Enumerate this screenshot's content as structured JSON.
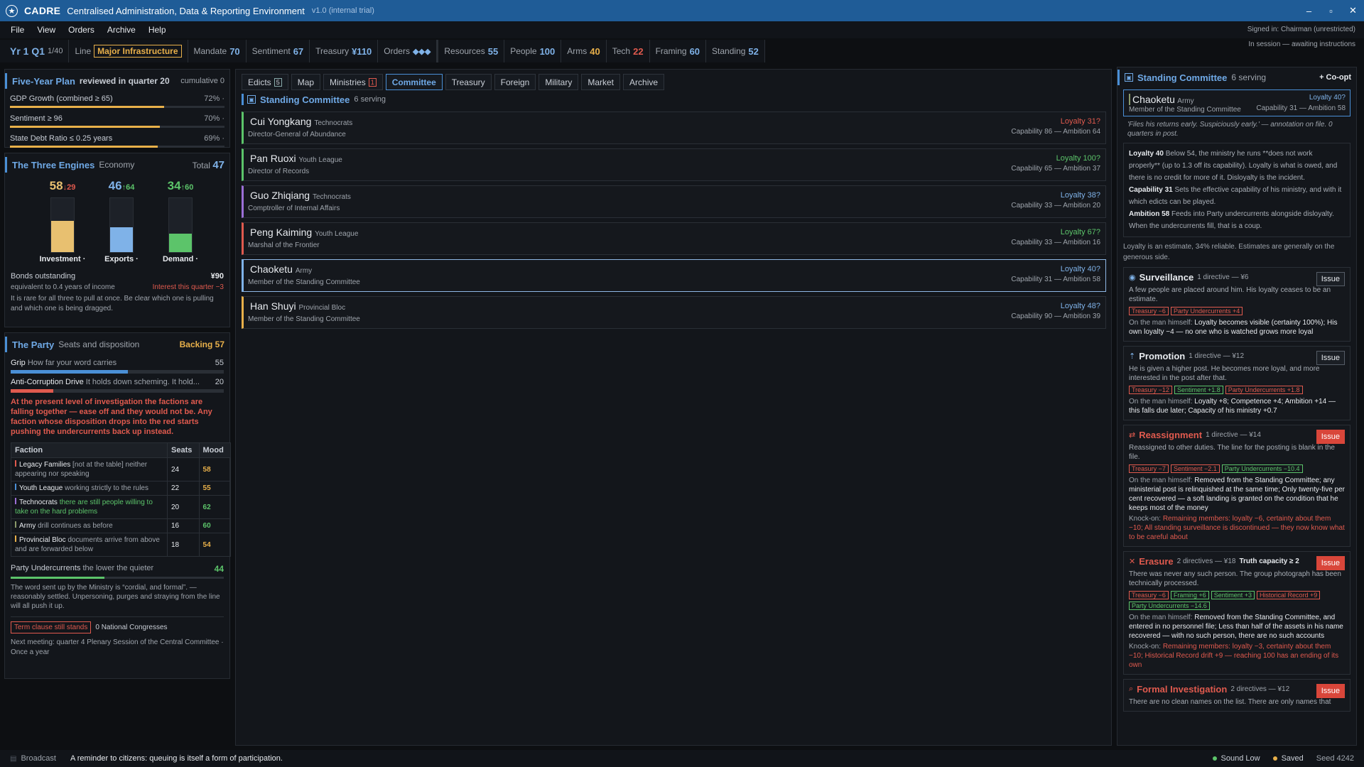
{
  "window": {
    "app_name": "CADRE",
    "full_name": "Centralised Administration, Data & Reporting Environment",
    "version": "v1.0 (internal trial)"
  },
  "menu": [
    "File",
    "View",
    "Orders",
    "Archive",
    "Help"
  ],
  "signed_in": "Signed in: Chairman (unrestricted)",
  "session": "In session — awaiting instructions",
  "stats": {
    "period": "Yr 1 Q1",
    "period_count": "1/40",
    "line_label": "Line",
    "line_value": "Major Infrastructure",
    "mandate_label": "Mandate",
    "mandate": "70",
    "sentiment_label": "Sentiment",
    "sentiment": "67",
    "treasury_label": "Treasury",
    "treasury": "¥110",
    "orders_label": "Orders",
    "orders": "◆◆◆",
    "resources_label": "Resources",
    "resources": "55",
    "people_label": "People",
    "people": "100",
    "arms_label": "Arms",
    "arms": "40",
    "tech_label": "Tech",
    "tech": "22",
    "framing_label": "Framing",
    "framing": "60",
    "standing_label": "Standing",
    "standing": "52"
  },
  "plan": {
    "title": "Five-Year Plan",
    "sub": "reviewed in quarter 20",
    "right": "cumulative 0",
    "goals": [
      {
        "label": "GDP Growth (combined ≥ 65)",
        "pct": "72% ·",
        "fill": 72
      },
      {
        "label": "Sentiment ≥ 96",
        "pct": "70% ·",
        "fill": 70
      },
      {
        "label": "State Debt Ratio ≤ 0.25 years",
        "pct": "69% ·",
        "fill": 69
      }
    ]
  },
  "engines": {
    "title": "The Three Engines",
    "sub": "Economy",
    "total_label": "Total",
    "total": "47",
    "items": [
      {
        "name": "Investment ·",
        "value": "58",
        "delta": "↓29",
        "fill": 0.58,
        "color": "#e8c070"
      },
      {
        "name": "Exports ·",
        "value": "46",
        "delta": "↑64",
        "fill": 0.46,
        "color": "#7fb2e8"
      },
      {
        "name": "Demand ·",
        "value": "34",
        "delta": "↑60",
        "fill": 0.34,
        "color": "#5cc46a"
      }
    ],
    "bonds_label": "Bonds outstanding",
    "bonds": "¥90",
    "bonds_note": "equivalent to 0.4 years of income",
    "interest": "Interest this quarter −3",
    "note": "It is rare for all three to pull at once. Be clear which one is pulling and which one is being dragged."
  },
  "party": {
    "title": "The Party",
    "sub": "Seats and disposition",
    "backing": "Backing 57",
    "grip_label": "Grip",
    "grip_note": "How far your word carries",
    "grip": "55",
    "grip_fill": 0.55,
    "acd_label": "Anti-Corruption Drive",
    "acd_note": "It holds down scheming. It hold...",
    "acd": "20",
    "acd_fill": 0.2,
    "warning": "At the present level of investigation the factions are falling together — ease off and they would not be. Any faction whose disposition drops into the red starts pushing the undercurrents back up instead.",
    "col_faction": "Faction",
    "col_seats": "Seats",
    "col_mood": "Mood",
    "factions": [
      {
        "name": "Legacy Families",
        "note": "[not at the table] neither appearing nor speaking",
        "seats": "24",
        "mood": "58",
        "color": "#e05a4e"
      },
      {
        "name": "Youth League",
        "note": "working strictly to the rules",
        "seats": "22",
        "mood": "55",
        "color": "#4a8fd6"
      },
      {
        "name": "Technocrats",
        "note": "there are still people willing to take on the hard problems",
        "seats": "20",
        "mood": "62",
        "color": "#9b6fd6"
      },
      {
        "name": "Army",
        "note": "drill continues as before",
        "seats": "16",
        "mood": "60",
        "color": "#8a9a6a"
      },
      {
        "name": "Provincial Bloc",
        "note": "documents arrive from above and are forwarded below",
        "seats": "18",
        "mood": "54",
        "color": "#e8b04a"
      }
    ],
    "under_label": "Party Undercurrents",
    "under_note": "the lower the quieter",
    "under": "44",
    "under_fill": 0.44,
    "word": "The word sent up by the Ministry is “cordial, and formal”. — reasonably settled. Unpersoning, purges and straying from the line will all push it up.",
    "term": "Term clause still stands",
    "congress": "0 National Congresses",
    "next_meeting": "Next meeting: quarter 4 Plenary Session of the Central Committee · Once a year"
  },
  "tabs": [
    {
      "label": "Edicts",
      "badge": "5"
    },
    {
      "label": "Map"
    },
    {
      "label": "Ministries",
      "badge": "1",
      "red": true
    },
    {
      "label": "Committee",
      "active": true
    },
    {
      "label": "Treasury"
    },
    {
      "label": "Foreign"
    },
    {
      "label": "Military"
    },
    {
      "label": "Market"
    },
    {
      "label": "Archive"
    }
  ],
  "committee": {
    "title": "Standing Committee",
    "count": "6 serving",
    "members": [
      {
        "name": "Cui Yongkang",
        "faction": "Technocrats",
        "role": "Director-General of Abundance",
        "loyalty": "Loyalty 31?",
        "loy_color": "#e05a4e",
        "cap": "Capability 86 — Ambition 64",
        "color": "#5cc46a"
      },
      {
        "name": "Pan Ruoxi",
        "faction": "Youth League",
        "role": "Director of Records",
        "loyalty": "Loyalty 100?",
        "loy_color": "#5cc46a",
        "cap": "Capability 65 — Ambition 37",
        "color": "#5cc46a"
      },
      {
        "name": "Guo Zhiqiang",
        "faction": "Technocrats",
        "role": "Comptroller of Internal Affairs",
        "loyalty": "Loyalty 38?",
        "loy_color": "#7fb2e8",
        "cap": "Capability 33 — Ambition 20",
        "color": "#9b6fd6"
      },
      {
        "name": "Peng Kaiming",
        "faction": "Youth League",
        "role": "Marshal of the Frontier",
        "loyalty": "Loyalty 67?",
        "loy_color": "#5cc46a",
        "cap": "Capability 33 — Ambition 16",
        "color": "#e05a4e"
      },
      {
        "name": "Chaoketu",
        "faction": "Army",
        "role": "Member of the Standing Committee",
        "loyalty": "Loyalty 40?",
        "loy_color": "#7fb2e8",
        "cap": "Capability 31 — Ambition 58",
        "color": "#7fb2e8",
        "selected": true
      },
      {
        "name": "Han Shuyi",
        "faction": "Provincial Bloc",
        "role": "Member of the Standing Committee",
        "loyalty": "Loyalty 48?",
        "loy_color": "#7fb2e8",
        "cap": "Capability 90 — Ambition 39",
        "color": "#e8b04a"
      }
    ]
  },
  "detail": {
    "title": "Standing Committee",
    "count": "6 serving",
    "coopt": "+ Co-opt",
    "name": "Chaoketu",
    "faction": "Army",
    "loyalty": "Loyalty 40?",
    "role": "Member of the Standing Committee",
    "cap": "Capability 31 — Ambition 58",
    "quote": "'Files his returns early. Suspiciously early.' — annotation on file. 0 quarters in post.",
    "loy_label": "Loyalty 40",
    "loy_text": "Below 54, the ministry he runs **does not work properly** (up to 1.3 off its capability). Loyalty is what is owed, and there is no credit for more of it. Disloyalty is the incident.",
    "cap_label": "Capability 31",
    "cap_text": "Sets the effective capability of his ministry, and with it which edicts can be played.",
    "amb_label": "Ambition 58",
    "amb_text": "Feeds into Party undercurrents alongside disloyalty. When the undercurrents fill, that is a coup.",
    "estimate": "Loyalty is an estimate, 34% reliable. Estimates are generally on the generous side.",
    "directives": [
      {
        "name": "Surveillance",
        "meta": "1 directive — ¥6",
        "hot": false,
        "icon": "eye-icon",
        "glyph": "◉",
        "desc": "A few people are placed around him. His loyalty ceases to be an estimate.",
        "chips": [
          {
            "t": "Treasury −6"
          },
          {
            "t": "Party Undercurrents +4"
          }
        ],
        "man_label": "On the man himself:",
        "man": "Loyalty becomes visible (certainty 100%); His own loyalty −4 — no one who is watched grows more loyal"
      },
      {
        "name": "Promotion",
        "meta": "1 directive — ¥12",
        "hot": false,
        "icon": "person-up-icon",
        "glyph": "⇡",
        "desc": "He is given a higher post. He becomes more loyal, and more interested in the post after that.",
        "chips": [
          {
            "t": "Treasury −12"
          },
          {
            "t": "Sentiment +1.8",
            "g": true
          },
          {
            "t": "Party Undercurrents +1.8"
          }
        ],
        "man_label": "On the man himself:",
        "man": "Loyalty +8; Competence +4; Ambition +14 — this falls due later; Capacity of his ministry +0.7"
      },
      {
        "name": "Reassignment",
        "meta": "1 directive — ¥14",
        "hot": true,
        "icon": "person-move-icon",
        "glyph": "⇄",
        "desc": "Reassigned to other duties. The line for the posting is blank in the file.",
        "chips": [
          {
            "t": "Treasury −7"
          },
          {
            "t": "Sentiment −2.1"
          },
          {
            "t": "Party Undercurrents −10.4",
            "g": true
          }
        ],
        "man_label": "On the man himself:",
        "man": "Removed from the Standing Committee; any ministerial post is relinquished at the same time; Only twenty-five per cent recovered — a soft landing is granted on the condition that he keeps most of the money",
        "knock_label": "Knock-on:",
        "knock": "Remaining members: loyalty −6, certainty about them −10; All standing surveillance is discontinued — they now know what to be careful about"
      },
      {
        "name": "Erasure",
        "meta": "2 directives — ¥18",
        "extra": "Truth capacity ≥ 2",
        "hot": true,
        "icon": "erase-icon",
        "glyph": "✕",
        "desc": "There was never any such person. The group photograph has been technically processed.",
        "chips": [
          {
            "t": "Treasury −6"
          },
          {
            "t": "Framing +6",
            "g": true
          },
          {
            "t": "Sentiment +3",
            "g": true
          },
          {
            "t": "Historical Record +9"
          },
          {
            "t": "Party Undercurrents −14.6",
            "g": true
          }
        ],
        "man_label": "On the man himself:",
        "man": "Removed from the Standing Committee, and entered in no personnel file; Less than half of the assets in his name recovered — with no such person, there are no such accounts",
        "knock_label": "Knock-on:",
        "knock": "Remaining members: loyalty −3, certainty about them −10; Historical Record drift +9 — reaching 100 has an ending of its own"
      },
      {
        "name": "Formal Investigation",
        "meta": "2 directives — ¥12",
        "hot": true,
        "icon": "search-icon",
        "glyph": "⌕",
        "desc": "There are no clean names on the list. There are only names that"
      }
    ]
  },
  "footer": {
    "broadcast": "Broadcast",
    "message": "A reminder to citizens: queuing is itself a form of participation.",
    "sound": "Sound Low",
    "saved": "Saved",
    "seed": "Seed 4242"
  },
  "issue_label": "Issue"
}
